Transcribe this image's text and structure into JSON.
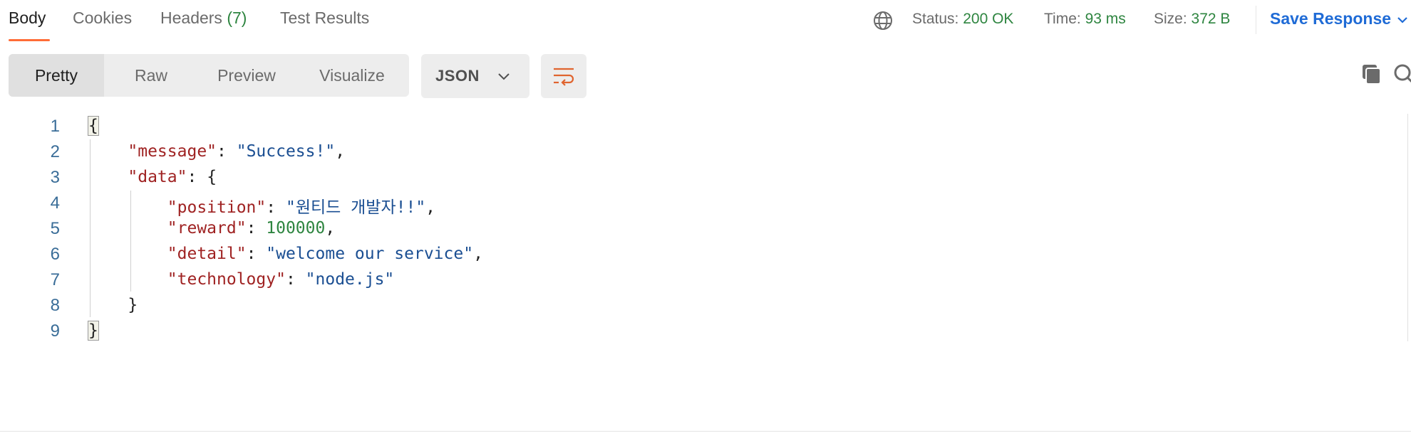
{
  "tabs": {
    "body": "Body",
    "cookies": "Cookies",
    "headers": "Headers",
    "headers_count": "(7)",
    "test_results": "Test Results"
  },
  "status": {
    "status_label": "Status:",
    "status_value": "200 OK",
    "time_label": "Time:",
    "time_value": "93 ms",
    "size_label": "Size:",
    "size_value": "372 B"
  },
  "save_response": "Save Response",
  "view_modes": [
    "Pretty",
    "Raw",
    "Preview",
    "Visualize"
  ],
  "format": "JSON",
  "colors": {
    "accent": "#ff6c37",
    "link": "#1f6bd6",
    "ok": "#2e8540",
    "key": "#9f2222",
    "string": "#1a4e92"
  },
  "icons": {
    "globe": "globe-icon",
    "chevron": "chevron-down-icon",
    "wrap": "wrap-lines-icon",
    "copy": "copy-icon",
    "search": "search-icon"
  },
  "code": {
    "line_numbers": [
      "1",
      "2",
      "3",
      "4",
      "5",
      "6",
      "7",
      "8",
      "9"
    ],
    "open_brace": "{",
    "close_brace": "}",
    "message_key": "\"message\"",
    "message_value": "\"Success!\"",
    "data_key": "\"data\"",
    "position_key": "\"position\"",
    "position_value": "\"원티드 개발자!!\"",
    "reward_key": "\"reward\"",
    "reward_value": "100000",
    "detail_key": "\"detail\"",
    "detail_value": "\"welcome our service\"",
    "technology_key": "\"technology\"",
    "technology_value": "\"node.js\""
  }
}
